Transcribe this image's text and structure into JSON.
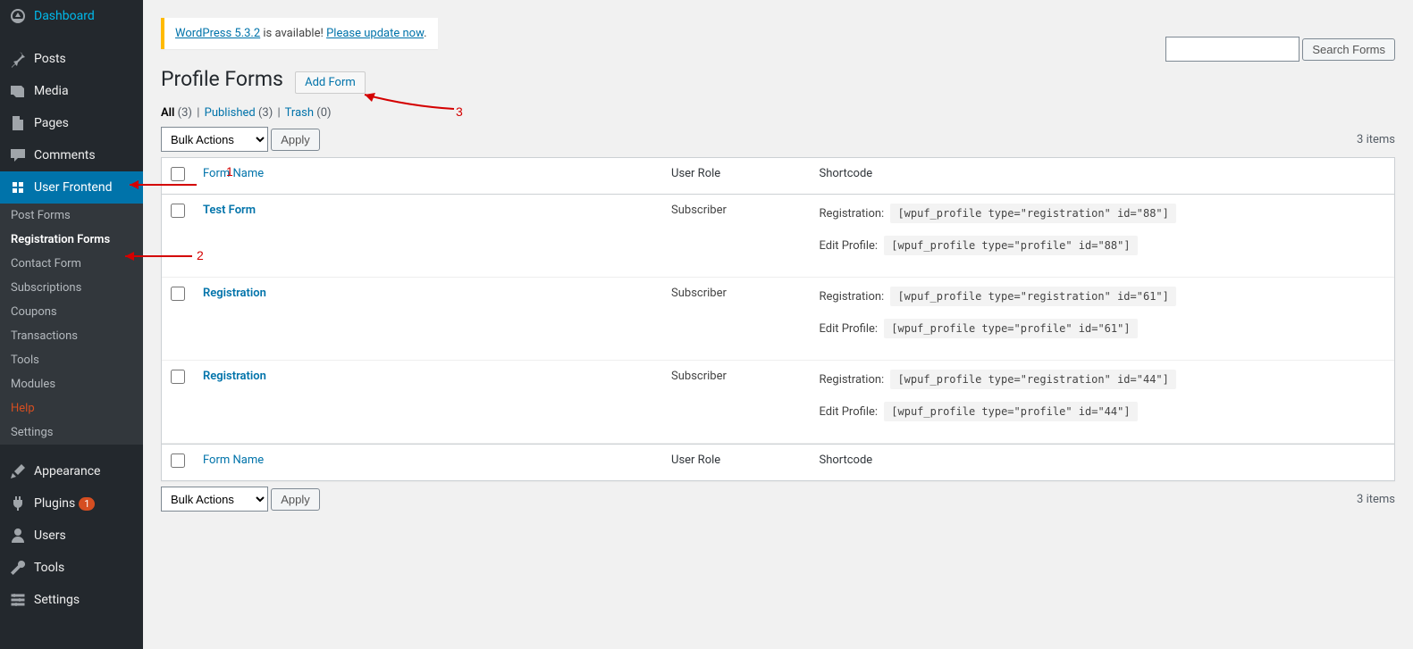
{
  "sidebar": {
    "items": [
      {
        "icon": "dashboard",
        "label": "Dashboard"
      },
      {
        "icon": "pin",
        "label": "Posts"
      },
      {
        "icon": "media",
        "label": "Media"
      },
      {
        "icon": "page",
        "label": "Pages"
      },
      {
        "icon": "comment",
        "label": "Comments"
      },
      {
        "icon": "userfrontend",
        "label": "User Frontend",
        "current": true
      },
      {
        "icon": "appearance",
        "label": "Appearance"
      },
      {
        "icon": "plugin",
        "label": "Plugins",
        "badge": "1"
      },
      {
        "icon": "users",
        "label": "Users"
      },
      {
        "icon": "tools",
        "label": "Tools"
      },
      {
        "icon": "settings",
        "label": "Settings"
      }
    ],
    "submenu": [
      {
        "label": "Post Forms"
      },
      {
        "label": "Registration Forms",
        "current": true
      },
      {
        "label": "Contact Form"
      },
      {
        "label": "Subscriptions"
      },
      {
        "label": "Coupons"
      },
      {
        "label": "Transactions"
      },
      {
        "label": "Tools"
      },
      {
        "label": "Modules"
      },
      {
        "label": "Help",
        "help": true
      },
      {
        "label": "Settings"
      }
    ]
  },
  "update_nag": {
    "pre": "WordPress 5.3.2",
    "mid": " is available! ",
    "link": "Please update now",
    "post": "."
  },
  "page": {
    "title": "Profile Forms",
    "add_button": "Add Form"
  },
  "filters": {
    "all": "All",
    "all_count": "(3)",
    "published": "Published",
    "published_count": "(3)",
    "trash": "Trash",
    "trash_count": "(0)"
  },
  "bulk": {
    "default": "Bulk Actions",
    "apply": "Apply"
  },
  "search": {
    "button": "Search Forms"
  },
  "table": {
    "cols": {
      "name": "Form Name",
      "role": "User Role",
      "shortcode": "Shortcode"
    },
    "shortcode_labels": {
      "reg": "Registration:",
      "edit": "Edit Profile:"
    },
    "rows": [
      {
        "name": "Test Form",
        "role": "Subscriber",
        "reg": "[wpuf_profile type=\"registration\" id=\"88\"]",
        "edit": "[wpuf_profile type=\"profile\" id=\"88\"]"
      },
      {
        "name": "Registration",
        "role": "Subscriber",
        "reg": "[wpuf_profile type=\"registration\" id=\"61\"]",
        "edit": "[wpuf_profile type=\"profile\" id=\"61\"]"
      },
      {
        "name": "Registration",
        "role": "Subscriber",
        "reg": "[wpuf_profile type=\"registration\" id=\"44\"]",
        "edit": "[wpuf_profile type=\"profile\" id=\"44\"]"
      }
    ]
  },
  "count_text": "3 items",
  "annotations": {
    "n1": "1",
    "n2": "2",
    "n3": "3"
  }
}
